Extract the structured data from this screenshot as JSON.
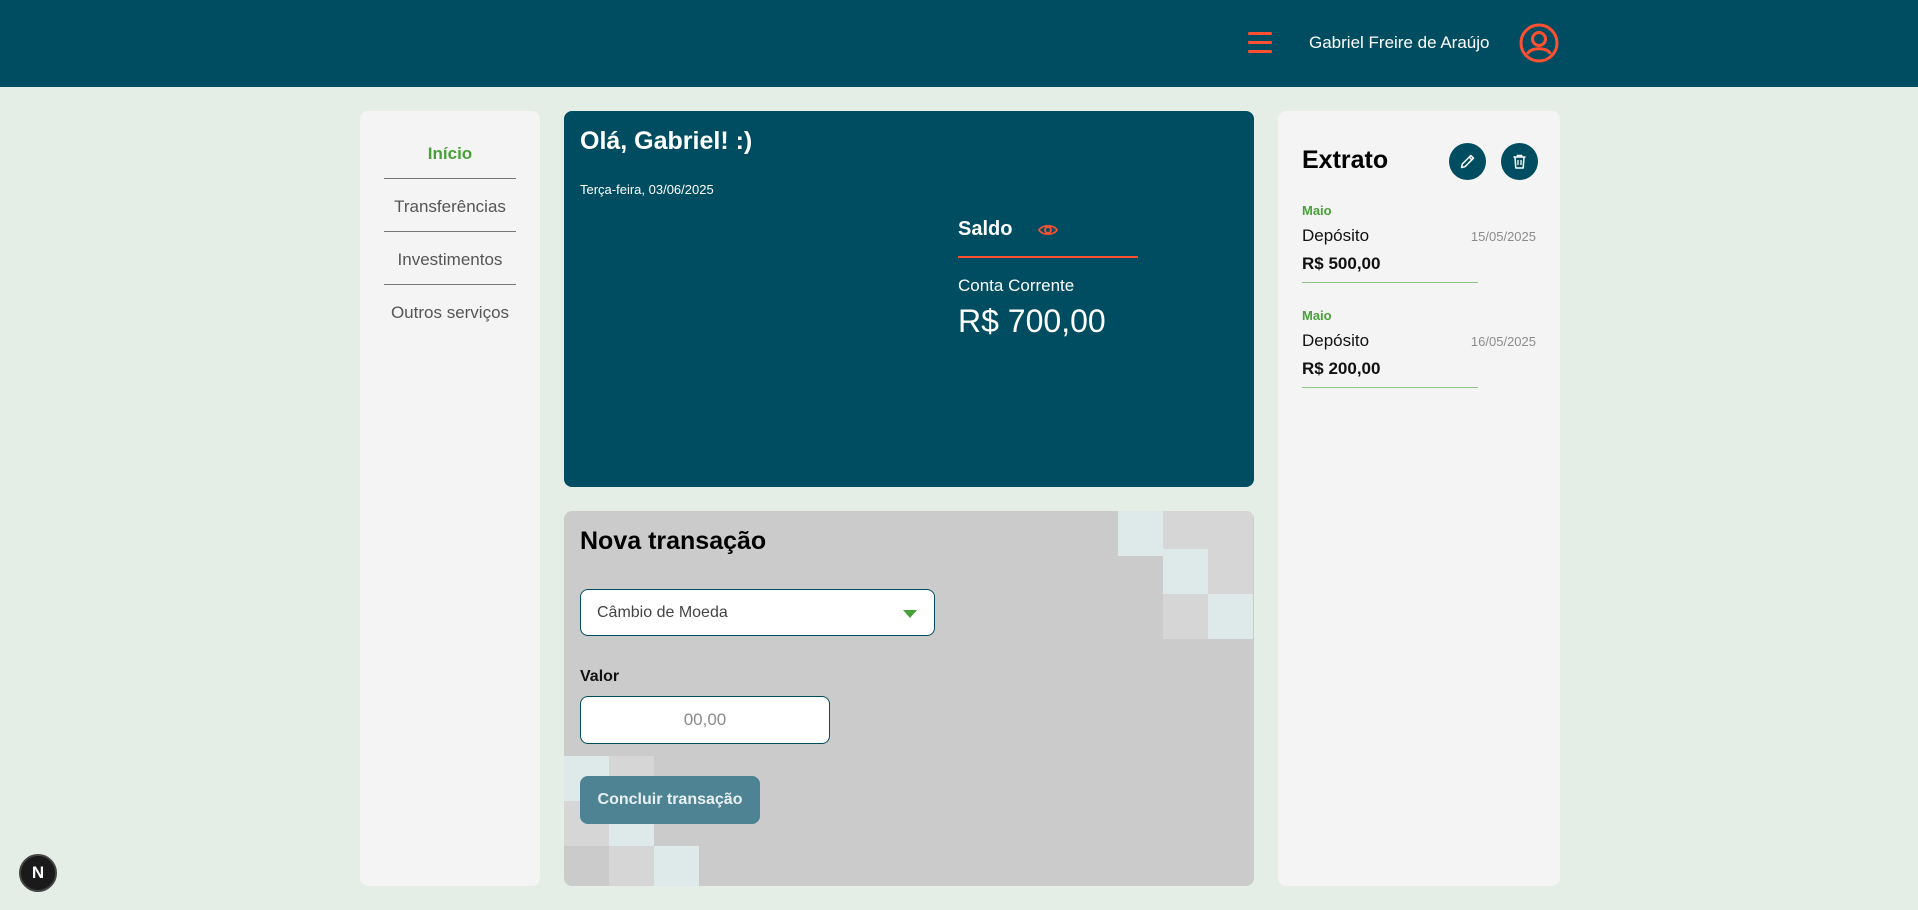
{
  "header": {
    "user_name": "Gabriel Freire de Araújo",
    "menu_icon": "hamburger-menu-icon",
    "avatar_icon": "user-circle-icon",
    "accent_color": "#ff5031",
    "background_color": "#004d61"
  },
  "sidebar": {
    "items": [
      {
        "label": "Início",
        "active": true
      },
      {
        "label": "Transferências",
        "active": false
      },
      {
        "label": "Investimentos",
        "active": false
      },
      {
        "label": "Outros serviços",
        "active": false
      }
    ]
  },
  "welcome": {
    "greeting": "Olá, Gabriel! :)",
    "date": "Terça-feira, 03/06/2025",
    "balance_title": "Saldo",
    "eye_icon": "eye-icon",
    "account_label": "Conta Corrente",
    "account_value": "R$ 700,00"
  },
  "transaction": {
    "title": "Nova transação",
    "type_selected": "Câmbio de Moeda",
    "amount_label": "Valor",
    "amount_placeholder": "00,00",
    "submit_label": "Concluir transação"
  },
  "statement": {
    "title": "Extrato",
    "edit_icon": "pencil-icon",
    "delete_icon": "trash-icon",
    "items": [
      {
        "month": "Maio",
        "type": "Depósito",
        "date": "15/05/2025",
        "amount": "R$ 500,00"
      },
      {
        "month": "Maio",
        "type": "Depósito",
        "date": "16/05/2025",
        "amount": "R$ 200,00"
      }
    ]
  },
  "dev_badge": {
    "label": "N"
  },
  "colors": {
    "page_background": "#e4ede6",
    "primary": "#004d61",
    "accent": "#ff5031",
    "success": "#47a138"
  }
}
